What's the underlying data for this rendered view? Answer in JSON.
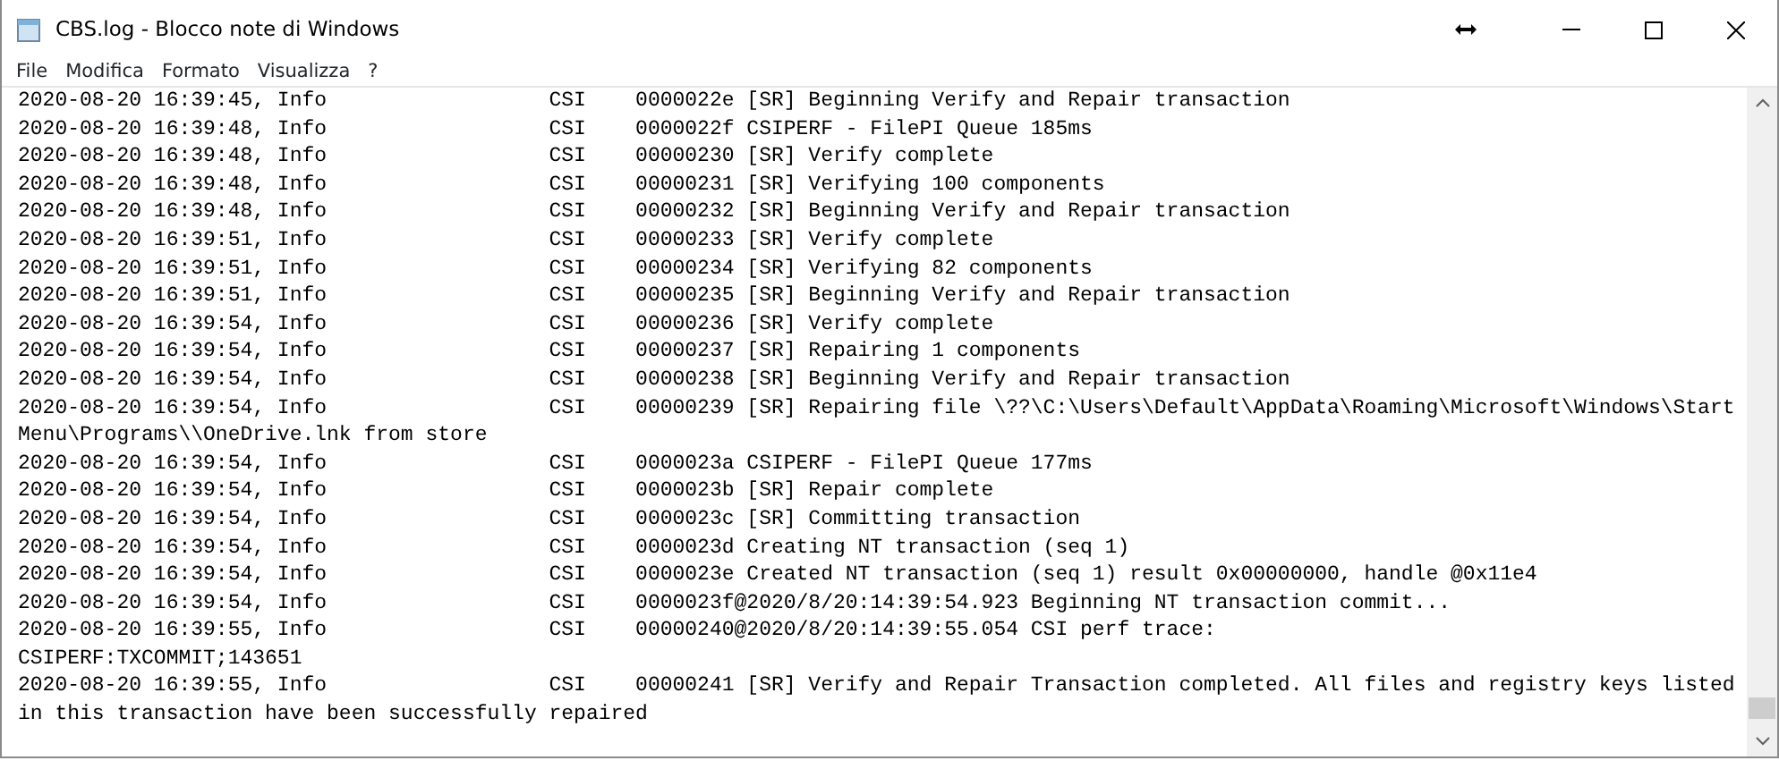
{
  "window": {
    "title": "CBS.log - Blocco note di Windows"
  },
  "menu": [
    {
      "label": "File"
    },
    {
      "label": "Modifica"
    },
    {
      "label": "Formato"
    },
    {
      "label": "Visualizza"
    },
    {
      "label": "?"
    }
  ],
  "lines": [
    "2020-08-20 16:39:45, Info                  CSI    0000022e [SR] Beginning Verify and Repair transaction",
    "2020-08-20 16:39:48, Info                  CSI    0000022f CSIPERF - FilePI Queue 185ms",
    "2020-08-20 16:39:48, Info                  CSI    00000230 [SR] Verify complete",
    "2020-08-20 16:39:48, Info                  CSI    00000231 [SR] Verifying 100 components",
    "2020-08-20 16:39:48, Info                  CSI    00000232 [SR] Beginning Verify and Repair transaction",
    "2020-08-20 16:39:51, Info                  CSI    00000233 [SR] Verify complete",
    "2020-08-20 16:39:51, Info                  CSI    00000234 [SR] Verifying 82 components",
    "2020-08-20 16:39:51, Info                  CSI    00000235 [SR] Beginning Verify and Repair transaction",
    "2020-08-20 16:39:54, Info                  CSI    00000236 [SR] Verify complete",
    "2020-08-20 16:39:54, Info                  CSI    00000237 [SR] Repairing 1 components",
    "2020-08-20 16:39:54, Info                  CSI    00000238 [SR] Beginning Verify and Repair transaction",
    "2020-08-20 16:39:54, Info                  CSI    00000239 [SR] Repairing file \\??\\C:\\Users\\Default\\AppData\\Roaming\\Microsoft\\Windows\\Start",
    "Menu\\Programs\\\\OneDrive.lnk from store",
    "2020-08-20 16:39:54, Info                  CSI    0000023a CSIPERF - FilePI Queue 177ms",
    "2020-08-20 16:39:54, Info                  CSI    0000023b [SR] Repair complete",
    "2020-08-20 16:39:54, Info                  CSI    0000023c [SR] Committing transaction",
    "2020-08-20 16:39:54, Info                  CSI    0000023d Creating NT transaction (seq 1)",
    "2020-08-20 16:39:54, Info                  CSI    0000023e Created NT transaction (seq 1) result 0x00000000, handle @0x11e4",
    "2020-08-20 16:39:54, Info                  CSI    0000023f@2020/8/20:14:39:54.923 Beginning NT transaction commit...",
    "2020-08-20 16:39:55, Info                  CSI    00000240@2020/8/20:14:39:55.054 CSI perf trace:",
    "CSIPERF:TXCOMMIT;143651",
    "2020-08-20 16:39:55, Info                  CSI    00000241 [SR] Verify and Repair Transaction completed. All files and registry keys listed",
    "in this transaction have been successfully repaired"
  ]
}
